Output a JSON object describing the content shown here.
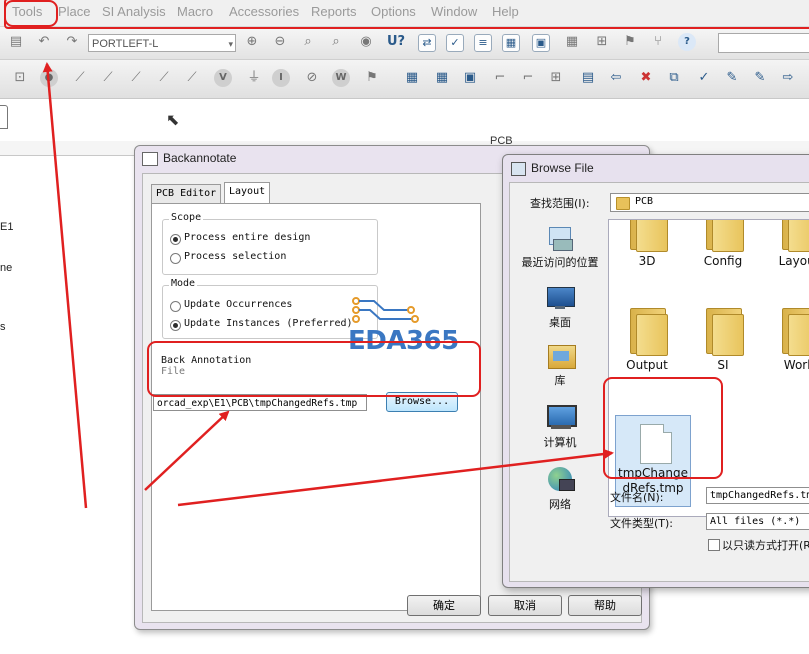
{
  "menubar": {
    "items": [
      "Tools",
      "Place",
      "SI Analysis",
      "Macro",
      "Accessories",
      "Reports",
      "Options",
      "Window",
      "Help"
    ]
  },
  "toolbar": {
    "part_combo": "PORTLEFT-L",
    "part_combo_arrow": "▾"
  },
  "left_panel": {
    "header": "PCB",
    "fragments": [
      "E1",
      "ne",
      "s"
    ]
  },
  "backannotate": {
    "title": "Backannotate",
    "tabs": [
      "PCB Editor",
      "Layout"
    ],
    "scope_label": "Scope",
    "scope_options": [
      "Process entire design",
      "Process selection"
    ],
    "mode_label": "Mode",
    "mode_options": [
      "Update Occurrences",
      "Update Instances (Preferred)"
    ],
    "back_annotation_label": "Back Annotation",
    "file_label": "File",
    "file_value": "orcad_exp\\E1\\PCB\\tmpChangedRefs.tmp",
    "browse_button": "Browse...",
    "ok_button": "确定",
    "cancel_button": "取消",
    "help_button": "帮助"
  },
  "browse_file": {
    "title": "Browse File",
    "look_in_label": "查找范围(I):",
    "look_in_value": "PCB",
    "places": [
      "最近访问的位置",
      "桌面",
      "库",
      "计算机",
      "网络"
    ],
    "folders": [
      "3D",
      "Config",
      "Layout",
      "Output",
      "SI",
      "Work"
    ],
    "selected_file": "tmpChangedRefs.tmp",
    "file_name_label": "文件名(N):",
    "file_name_value": "tmpChangedRefs.tmp",
    "file_type_label": "文件类型(T):",
    "file_type_value": "All files (*.*)",
    "readonly_label": "以只读方式打开(R)"
  },
  "watermark": {
    "text": "EDA365"
  },
  "colors": {
    "annotation_red": "#e02020",
    "watermark_blue": "#3a77c2",
    "selection_blue": "#d6e8f8"
  }
}
